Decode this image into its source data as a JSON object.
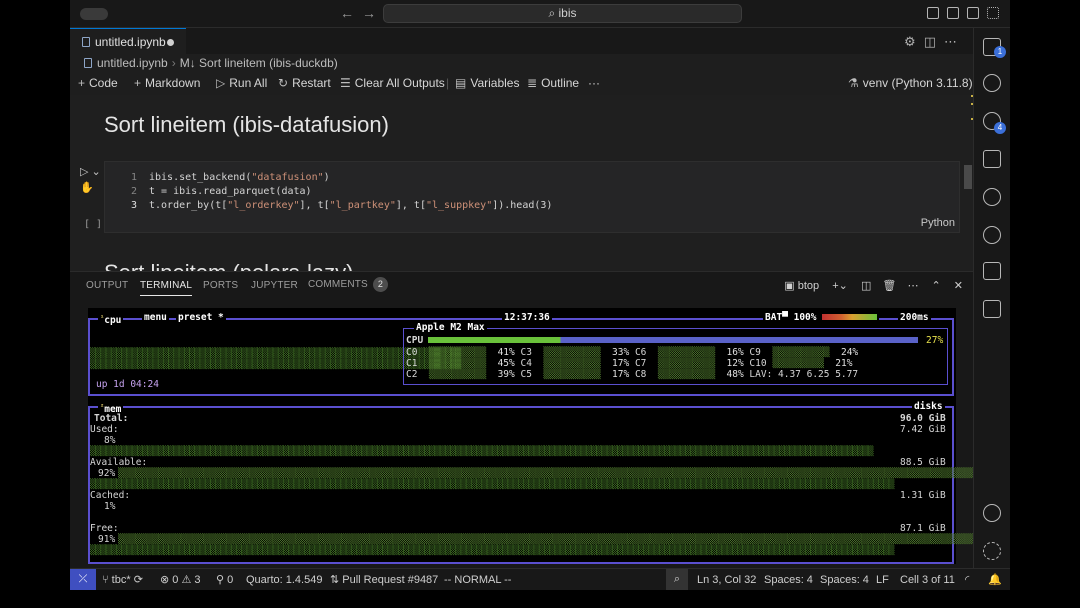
{
  "window": {
    "search_text": "ibis"
  },
  "editor": {
    "tab_title": "untitled.ipynb",
    "breadcrumb": [
      "untitled.ipynb",
      "M↓ Sort lineitem (ibis-duckdb)"
    ]
  },
  "toolbar": {
    "code": "Code",
    "markdown": "Markdown",
    "run_all": "Run All",
    "restart": "Restart",
    "clear_outputs": "Clear All Outputs",
    "variables": "Variables",
    "outline": "Outline",
    "more": "···",
    "kernel": "venv (Python 3.11.8)"
  },
  "notebook": {
    "heading1": "Sort lineitem (ibis-datafusion)",
    "heading2": "Sort lineitem (polars-lazy)",
    "cell": {
      "line_numbers": [
        "1",
        "2",
        "3"
      ],
      "language": "Python",
      "exec_count": "[ ]"
    }
  },
  "panel": {
    "tabs": [
      "OUTPUT",
      "TERMINAL",
      "PORTS",
      "JUPYTER",
      "COMMENTS"
    ],
    "comments_count": "2",
    "terminal_name": "btop"
  },
  "btop": {
    "cpu_title": "cpu",
    "menu": "menu",
    "preset": "preset *",
    "clock": "12:37:36",
    "bat_label": "BAT▀ 100%",
    "interval": "200ms",
    "cpu_model": "Apple M2 Max",
    "cpu_label": "CPU",
    "cpu_total": "27%",
    "cores": [
      {
        "name": "C0",
        "pct": "41%"
      },
      {
        "name": "C1",
        "pct": "45%"
      },
      {
        "name": "C2",
        "pct": "39%"
      },
      {
        "name": "C3",
        "pct": "33%"
      },
      {
        "name": "C4",
        "pct": "17%"
      },
      {
        "name": "C5",
        "pct": "17%"
      },
      {
        "name": "C6",
        "pct": "16%"
      },
      {
        "name": "C7",
        "pct": "12%"
      },
      {
        "name": "C8",
        "pct": "48%"
      },
      {
        "name": "C9",
        "pct": "24%"
      },
      {
        "name": "C10",
        "pct": "21%"
      }
    ],
    "lav": "LAV: 4.37 6.25 5.77",
    "uptime": "up 1d 04:24",
    "mem_title": "mem",
    "disks_title": "disks",
    "mem": {
      "total_label": "Total:",
      "total_value": "96.0 GiB",
      "used_label": "Used:",
      "used_value": "7.42 GiB",
      "used_pct": "8%",
      "avail_label": "Available:",
      "avail_value": "88.5 GiB",
      "avail_pct": "92%",
      "cached_label": "Cached:",
      "cached_value": "1.31 GiB",
      "cached_pct": "1%",
      "free_label": "Free:",
      "free_value": "87.1 GiB",
      "free_pct": "91%"
    }
  },
  "status": {
    "branch": "tbc*",
    "problems": "0",
    "warnings": "3",
    "ports": "0",
    "quarto": "Quarto: 1.4.549",
    "pr": "Pull Request #9487",
    "vim_mode": "-- NORMAL --",
    "position": "Ln 3, Col 32",
    "spaces1": "Spaces: 4",
    "spaces2": "Spaces: 4",
    "eol": "LF",
    "cell_pos": "Cell 3 of 11"
  },
  "activity_badges": {
    "explorer": "1",
    "scm": "4"
  }
}
